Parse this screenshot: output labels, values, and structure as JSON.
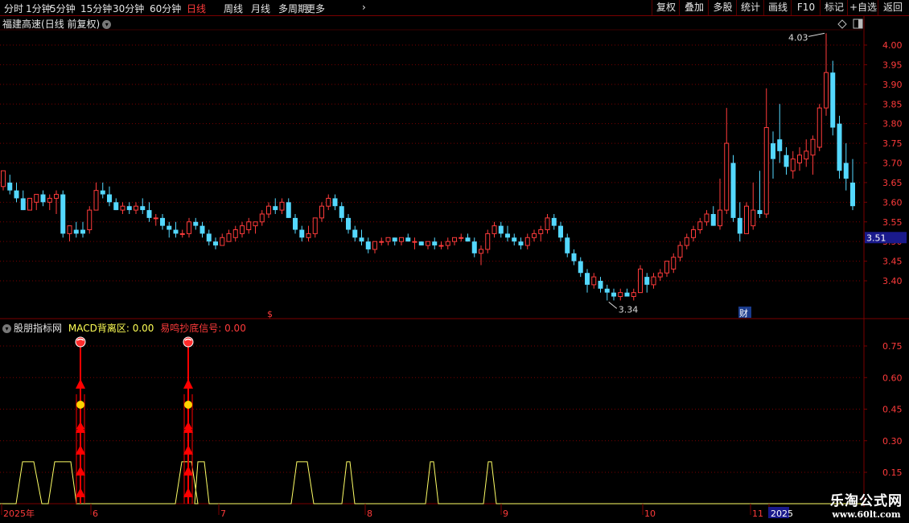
{
  "toolbar": {
    "periods": [
      "分时",
      "1分钟",
      "5分钟",
      "15分钟",
      "30分钟",
      "60分钟",
      "日线",
      "周线",
      "月线",
      "多周期",
      "更多"
    ],
    "active_period": "日线",
    "right_buttons": [
      "复权",
      "叠加",
      "多股",
      "统计",
      "画线",
      "F10",
      "标记",
      "+自选",
      "返回"
    ]
  },
  "chart_header": {
    "stock_name": "福建高速",
    "mode": "(日线 前复权)"
  },
  "indicator_header": {
    "source": "股朋指标网",
    "macd_label": "MACD背离区:",
    "macd_value": "0.00",
    "signal_label": "易鸣抄底信号:",
    "signal_value": "0.00"
  },
  "price_axis": {
    "ticks": [
      "4.00",
      "3.95",
      "3.90",
      "3.85",
      "3.80",
      "3.75",
      "3.70",
      "3.65",
      "3.60",
      "3.55",
      "3.50",
      "3.45",
      "3.40"
    ],
    "current_price": "3.51",
    "high_label": "4.03",
    "low_label": "3.34"
  },
  "indicator_axis": {
    "ticks": [
      "0.75",
      "0.60",
      "0.45",
      "0.30",
      "0.15"
    ]
  },
  "time_axis": {
    "labels": [
      "2025年",
      "6",
      "7",
      "8",
      "9",
      "10",
      "11",
      "2025"
    ]
  },
  "markers": {
    "dividend": "$",
    "finance": "财"
  },
  "watermark": {
    "name": "乐淘公式网",
    "url": "www.60lt.com"
  },
  "colors": {
    "up": "#ff3b3b",
    "down": "#54d8ff",
    "grid": "#7a0000",
    "signal_line": "#ffff66",
    "active": "#ff3b3b"
  },
  "chart_data": {
    "type": "candlestick",
    "price_range": [
      3.3,
      4.05
    ],
    "candles": [
      {
        "o": 3.64,
        "h": 3.68,
        "l": 3.63,
        "c": 3.68
      },
      {
        "o": 3.65,
        "h": 3.67,
        "l": 3.62,
        "c": 3.63
      },
      {
        "o": 3.63,
        "h": 3.65,
        "l": 3.6,
        "c": 3.61
      },
      {
        "o": 3.61,
        "h": 3.63,
        "l": 3.58,
        "c": 3.58
      },
      {
        "o": 3.58,
        "h": 3.61,
        "l": 3.58,
        "c": 3.61
      },
      {
        "o": 3.6,
        "h": 3.62,
        "l": 3.58,
        "c": 3.62
      },
      {
        "o": 3.62,
        "h": 3.63,
        "l": 3.59,
        "c": 3.6
      },
      {
        "o": 3.6,
        "h": 3.62,
        "l": 3.58,
        "c": 3.61
      },
      {
        "o": 3.61,
        "h": 3.63,
        "l": 3.57,
        "c": 3.62
      },
      {
        "o": 3.62,
        "h": 3.63,
        "l": 3.51,
        "c": 3.52
      },
      {
        "o": 3.52,
        "h": 3.54,
        "l": 3.5,
        "c": 3.54
      },
      {
        "o": 3.53,
        "h": 3.55,
        "l": 3.51,
        "c": 3.52
      },
      {
        "o": 3.53,
        "h": 3.55,
        "l": 3.51,
        "c": 3.52
      },
      {
        "o": 3.53,
        "h": 3.59,
        "l": 3.52,
        "c": 3.58
      },
      {
        "o": 3.58,
        "h": 3.65,
        "l": 3.58,
        "c": 3.63
      },
      {
        "o": 3.63,
        "h": 3.65,
        "l": 3.61,
        "c": 3.62
      },
      {
        "o": 3.62,
        "h": 3.64,
        "l": 3.59,
        "c": 3.6
      },
      {
        "o": 3.6,
        "h": 3.61,
        "l": 3.58,
        "c": 3.58
      },
      {
        "o": 3.58,
        "h": 3.6,
        "l": 3.57,
        "c": 3.59
      },
      {
        "o": 3.59,
        "h": 3.6,
        "l": 3.57,
        "c": 3.58
      },
      {
        "o": 3.58,
        "h": 3.6,
        "l": 3.57,
        "c": 3.59
      },
      {
        "o": 3.59,
        "h": 3.61,
        "l": 3.57,
        "c": 3.58
      },
      {
        "o": 3.58,
        "h": 3.6,
        "l": 3.55,
        "c": 3.56
      },
      {
        "o": 3.56,
        "h": 3.57,
        "l": 3.54,
        "c": 3.56
      },
      {
        "o": 3.56,
        "h": 3.57,
        "l": 3.53,
        "c": 3.54
      },
      {
        "o": 3.54,
        "h": 3.55,
        "l": 3.51,
        "c": 3.53
      },
      {
        "o": 3.53,
        "h": 3.55,
        "l": 3.51,
        "c": 3.52
      },
      {
        "o": 3.52,
        "h": 3.53,
        "l": 3.51,
        "c": 3.52
      },
      {
        "o": 3.52,
        "h": 3.56,
        "l": 3.51,
        "c": 3.55
      },
      {
        "o": 3.55,
        "h": 3.56,
        "l": 3.53,
        "c": 3.54
      },
      {
        "o": 3.54,
        "h": 3.55,
        "l": 3.51,
        "c": 3.52
      },
      {
        "o": 3.52,
        "h": 3.53,
        "l": 3.49,
        "c": 3.5
      },
      {
        "o": 3.5,
        "h": 3.51,
        "l": 3.48,
        "c": 3.49
      },
      {
        "o": 3.49,
        "h": 3.52,
        "l": 3.49,
        "c": 3.51
      },
      {
        "o": 3.5,
        "h": 3.53,
        "l": 3.5,
        "c": 3.52
      },
      {
        "o": 3.51,
        "h": 3.54,
        "l": 3.5,
        "c": 3.53
      },
      {
        "o": 3.52,
        "h": 3.55,
        "l": 3.51,
        "c": 3.54
      },
      {
        "o": 3.53,
        "h": 3.56,
        "l": 3.52,
        "c": 3.55
      },
      {
        "o": 3.54,
        "h": 3.55,
        "l": 3.52,
        "c": 3.55
      },
      {
        "o": 3.55,
        "h": 3.58,
        "l": 3.54,
        "c": 3.57
      },
      {
        "o": 3.57,
        "h": 3.6,
        "l": 3.56,
        "c": 3.59
      },
      {
        "o": 3.59,
        "h": 3.61,
        "l": 3.57,
        "c": 3.58
      },
      {
        "o": 3.58,
        "h": 3.61,
        "l": 3.57,
        "c": 3.6
      },
      {
        "o": 3.6,
        "h": 3.61,
        "l": 3.56,
        "c": 3.56
      },
      {
        "o": 3.56,
        "h": 3.57,
        "l": 3.52,
        "c": 3.53
      },
      {
        "o": 3.53,
        "h": 3.54,
        "l": 3.5,
        "c": 3.51
      },
      {
        "o": 3.51,
        "h": 3.54,
        "l": 3.5,
        "c": 3.52
      },
      {
        "o": 3.52,
        "h": 3.56,
        "l": 3.51,
        "c": 3.56
      },
      {
        "o": 3.56,
        "h": 3.6,
        "l": 3.55,
        "c": 3.59
      },
      {
        "o": 3.59,
        "h": 3.62,
        "l": 3.58,
        "c": 3.61
      },
      {
        "o": 3.61,
        "h": 3.62,
        "l": 3.58,
        "c": 3.59
      },
      {
        "o": 3.59,
        "h": 3.6,
        "l": 3.55,
        "c": 3.56
      },
      {
        "o": 3.56,
        "h": 3.57,
        "l": 3.52,
        "c": 3.53
      },
      {
        "o": 3.53,
        "h": 3.54,
        "l": 3.5,
        "c": 3.51
      },
      {
        "o": 3.51,
        "h": 3.53,
        "l": 3.49,
        "c": 3.5
      },
      {
        "o": 3.5,
        "h": 3.51,
        "l": 3.47,
        "c": 3.48
      },
      {
        "o": 3.48,
        "h": 3.5,
        "l": 3.47,
        "c": 3.5
      },
      {
        "o": 3.5,
        "h": 3.51,
        "l": 3.49,
        "c": 3.5
      },
      {
        "o": 3.5,
        "h": 3.51,
        "l": 3.49,
        "c": 3.51
      },
      {
        "o": 3.51,
        "h": 3.51,
        "l": 3.49,
        "c": 3.5
      },
      {
        "o": 3.5,
        "h": 3.51,
        "l": 3.49,
        "c": 3.51
      },
      {
        "o": 3.51,
        "h": 3.52,
        "l": 3.5,
        "c": 3.5
      },
      {
        "o": 3.5,
        "h": 3.51,
        "l": 3.48,
        "c": 3.5
      },
      {
        "o": 3.5,
        "h": 3.5,
        "l": 3.49,
        "c": 3.49
      },
      {
        "o": 3.49,
        "h": 3.5,
        "l": 3.48,
        "c": 3.5
      },
      {
        "o": 3.5,
        "h": 3.51,
        "l": 3.48,
        "c": 3.49
      },
      {
        "o": 3.49,
        "h": 3.5,
        "l": 3.48,
        "c": 3.49
      },
      {
        "o": 3.49,
        "h": 3.51,
        "l": 3.48,
        "c": 3.5
      },
      {
        "o": 3.5,
        "h": 3.51,
        "l": 3.49,
        "c": 3.51
      },
      {
        "o": 3.51,
        "h": 3.52,
        "l": 3.5,
        "c": 3.51
      },
      {
        "o": 3.51,
        "h": 3.52,
        "l": 3.5,
        "c": 3.5
      },
      {
        "o": 3.5,
        "h": 3.51,
        "l": 3.46,
        "c": 3.47
      },
      {
        "o": 3.47,
        "h": 3.49,
        "l": 3.44,
        "c": 3.48
      },
      {
        "o": 3.48,
        "h": 3.53,
        "l": 3.47,
        "c": 3.52
      },
      {
        "o": 3.52,
        "h": 3.55,
        "l": 3.51,
        "c": 3.54
      },
      {
        "o": 3.54,
        "h": 3.55,
        "l": 3.51,
        "c": 3.52
      },
      {
        "o": 3.52,
        "h": 3.54,
        "l": 3.5,
        "c": 3.51
      },
      {
        "o": 3.51,
        "h": 3.52,
        "l": 3.49,
        "c": 3.5
      },
      {
        "o": 3.5,
        "h": 3.51,
        "l": 3.48,
        "c": 3.49
      },
      {
        "o": 3.49,
        "h": 3.52,
        "l": 3.48,
        "c": 3.51
      },
      {
        "o": 3.51,
        "h": 3.53,
        "l": 3.5,
        "c": 3.52
      },
      {
        "o": 3.52,
        "h": 3.54,
        "l": 3.5,
        "c": 3.53
      },
      {
        "o": 3.53,
        "h": 3.57,
        "l": 3.52,
        "c": 3.56
      },
      {
        "o": 3.56,
        "h": 3.57,
        "l": 3.53,
        "c": 3.54
      },
      {
        "o": 3.54,
        "h": 3.55,
        "l": 3.5,
        "c": 3.51
      },
      {
        "o": 3.51,
        "h": 3.52,
        "l": 3.46,
        "c": 3.47
      },
      {
        "o": 3.47,
        "h": 3.48,
        "l": 3.44,
        "c": 3.45
      },
      {
        "o": 3.45,
        "h": 3.46,
        "l": 3.41,
        "c": 3.42
      },
      {
        "o": 3.42,
        "h": 3.43,
        "l": 3.37,
        "c": 3.39
      },
      {
        "o": 3.39,
        "h": 3.42,
        "l": 3.38,
        "c": 3.41
      },
      {
        "o": 3.4,
        "h": 3.41,
        "l": 3.37,
        "c": 3.38
      },
      {
        "o": 3.38,
        "h": 3.39,
        "l": 3.35,
        "c": 3.37
      },
      {
        "o": 3.37,
        "h": 3.38,
        "l": 3.35,
        "c": 3.36
      },
      {
        "o": 3.36,
        "h": 3.38,
        "l": 3.35,
        "c": 3.37
      },
      {
        "o": 3.37,
        "h": 3.38,
        "l": 3.36,
        "c": 3.36
      },
      {
        "o": 3.36,
        "h": 3.38,
        "l": 3.35,
        "c": 3.37
      },
      {
        "o": 3.37,
        "h": 3.44,
        "l": 3.37,
        "c": 3.43
      },
      {
        "o": 3.41,
        "h": 3.42,
        "l": 3.37,
        "c": 3.39
      },
      {
        "o": 3.39,
        "h": 3.42,
        "l": 3.38,
        "c": 3.41
      },
      {
        "o": 3.41,
        "h": 3.43,
        "l": 3.4,
        "c": 3.42
      },
      {
        "o": 3.42,
        "h": 3.45,
        "l": 3.41,
        "c": 3.45
      },
      {
        "o": 3.43,
        "h": 3.47,
        "l": 3.42,
        "c": 3.46
      },
      {
        "o": 3.46,
        "h": 3.5,
        "l": 3.45,
        "c": 3.49
      },
      {
        "o": 3.49,
        "h": 3.52,
        "l": 3.48,
        "c": 3.51
      },
      {
        "o": 3.51,
        "h": 3.54,
        "l": 3.5,
        "c": 3.53
      },
      {
        "o": 3.53,
        "h": 3.56,
        "l": 3.52,
        "c": 3.55
      },
      {
        "o": 3.55,
        "h": 3.58,
        "l": 3.54,
        "c": 3.57
      },
      {
        "o": 3.57,
        "h": 3.59,
        "l": 3.54,
        "c": 3.54
      },
      {
        "o": 3.54,
        "h": 3.66,
        "l": 3.53,
        "c": 3.58
      },
      {
        "o": 3.58,
        "h": 3.84,
        "l": 3.57,
        "c": 3.75
      },
      {
        "o": 3.7,
        "h": 3.72,
        "l": 3.55,
        "c": 3.56
      },
      {
        "o": 3.56,
        "h": 3.6,
        "l": 3.5,
        "c": 3.52
      },
      {
        "o": 3.52,
        "h": 3.6,
        "l": 3.52,
        "c": 3.59
      },
      {
        "o": 3.54,
        "h": 3.65,
        "l": 3.53,
        "c": 3.58
      },
      {
        "o": 3.58,
        "h": 3.68,
        "l": 3.56,
        "c": 3.57
      },
      {
        "o": 3.57,
        "h": 3.89,
        "l": 3.56,
        "c": 3.79
      },
      {
        "o": 3.75,
        "h": 3.78,
        "l": 3.66,
        "c": 3.71
      },
      {
        "o": 3.76,
        "h": 3.85,
        "l": 3.7,
        "c": 3.73
      },
      {
        "o": 3.72,
        "h": 3.74,
        "l": 3.67,
        "c": 3.69
      },
      {
        "o": 3.68,
        "h": 3.73,
        "l": 3.66,
        "c": 3.71
      },
      {
        "o": 3.7,
        "h": 3.74,
        "l": 3.68,
        "c": 3.72
      },
      {
        "o": 3.71,
        "h": 3.76,
        "l": 3.69,
        "c": 3.73
      },
      {
        "o": 3.72,
        "h": 3.77,
        "l": 3.67,
        "c": 3.76
      },
      {
        "o": 3.74,
        "h": 3.85,
        "l": 3.73,
        "c": 3.84
      },
      {
        "o": 3.84,
        "h": 4.03,
        "l": 3.82,
        "c": 3.93
      },
      {
        "o": 3.93,
        "h": 3.96,
        "l": 3.77,
        "c": 3.79
      },
      {
        "o": 3.8,
        "h": 3.82,
        "l": 3.66,
        "c": 3.68
      },
      {
        "o": 3.7,
        "h": 3.75,
        "l": 3.63,
        "c": 3.66
      },
      {
        "o": 3.65,
        "h": 3.71,
        "l": 3.58,
        "c": 3.59
      }
    ],
    "indicator": {
      "signal_line_peaks_at": [
        0.2
      ],
      "signal_columns": 2
    }
  }
}
